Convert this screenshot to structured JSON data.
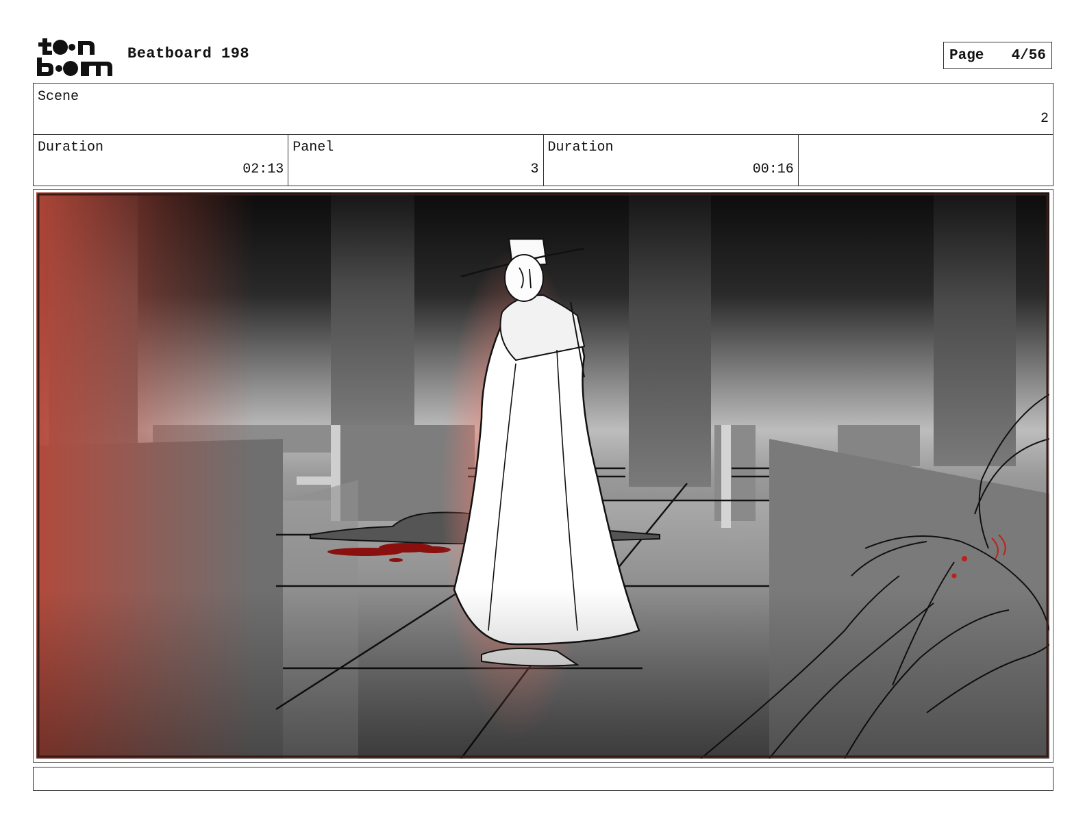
{
  "header": {
    "logo_text": "toon boom",
    "title": "Beatboard 198",
    "page_label": "Page",
    "page_value": "4/56"
  },
  "info": {
    "scene_label": "Scene",
    "scene_value": "2",
    "duration_label": "Duration",
    "duration_value": "02:13",
    "panel_label": "Panel",
    "panel_value": "3",
    "panel_duration_label": "Duration",
    "panel_duration_value": "00:16",
    "extra_value": ""
  },
  "panel": {
    "accent_color": "#b5483a",
    "blood_color": "#8a1010"
  },
  "caption": {
    "text": ""
  }
}
